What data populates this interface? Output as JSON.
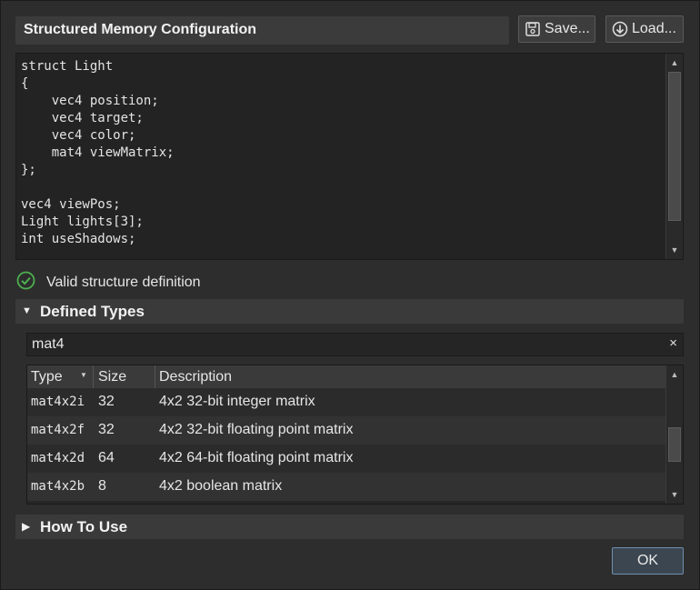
{
  "header": {
    "title": "Structured Memory Configuration",
    "save_label": "Save...",
    "load_label": "Load..."
  },
  "editor": {
    "code": "struct Light\n{\n    vec4 position;\n    vec4 target;\n    vec4 color;\n    mat4 viewMatrix;\n};\n\nvec4 viewPos;\nLight lights[3];\nint useShadows;"
  },
  "status": {
    "text": "Valid structure definition",
    "color": "#4caf50"
  },
  "defined_types": {
    "label": "Defined Types",
    "filter_value": "mat4",
    "clear_icon": "×",
    "columns": {
      "type": "Type",
      "size": "Size",
      "description": "Description"
    },
    "rows": [
      {
        "type": "mat4x2i",
        "size": "32",
        "description": "4x2 32-bit integer matrix"
      },
      {
        "type": "mat4x2f",
        "size": "32",
        "description": "4x2 32-bit floating point matrix"
      },
      {
        "type": "mat4x2d",
        "size": "64",
        "description": "4x2 64-bit floating point matrix"
      },
      {
        "type": "mat4x2b",
        "size": "8",
        "description": "4x2 boolean matrix"
      }
    ]
  },
  "how_to_use": {
    "label": "How To Use"
  },
  "footer": {
    "ok_label": "OK"
  },
  "colors": {
    "accent": "#6f8fae",
    "background": "#2d2d2d"
  }
}
